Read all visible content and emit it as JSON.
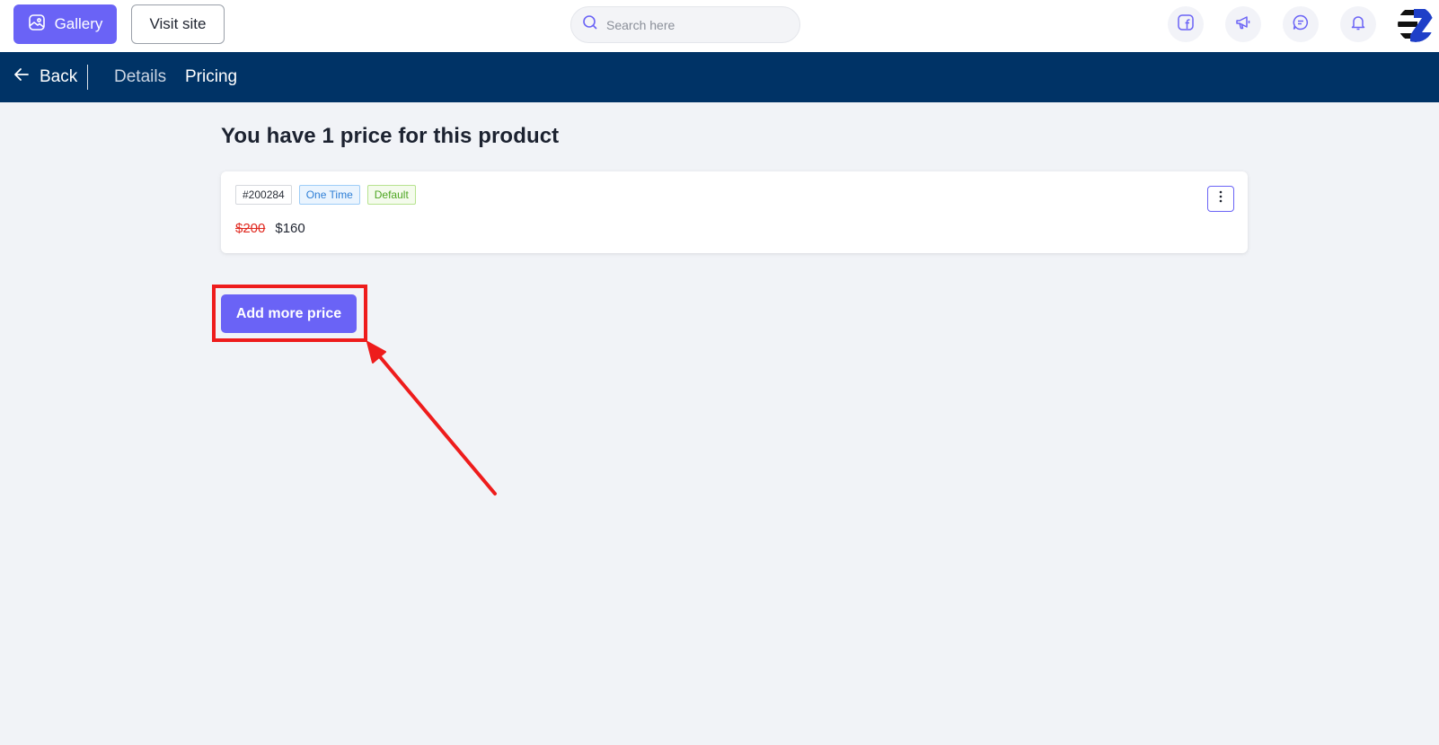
{
  "topbar": {
    "gallery_label": "Gallery",
    "visit_site_label": "Visit site",
    "search_placeholder": "Search here",
    "icons": [
      "facebook-icon",
      "megaphone-icon",
      "chat-icon",
      "bell-icon"
    ]
  },
  "subnav": {
    "back_label": "Back",
    "tabs": [
      {
        "label": "Details",
        "active": false
      },
      {
        "label": "Pricing",
        "active": true
      }
    ]
  },
  "main": {
    "heading": "You have 1 price for this product",
    "prices": [
      {
        "id": "#200284",
        "type": "One Time",
        "badge": "Default",
        "original_price": "$200",
        "price": "$160"
      }
    ],
    "add_button_label": "Add more price"
  },
  "colors": {
    "brand": "#6a63f6",
    "navbar": "#003366",
    "annotation": "#ee1c1c",
    "strike_price": "#e0281f"
  }
}
